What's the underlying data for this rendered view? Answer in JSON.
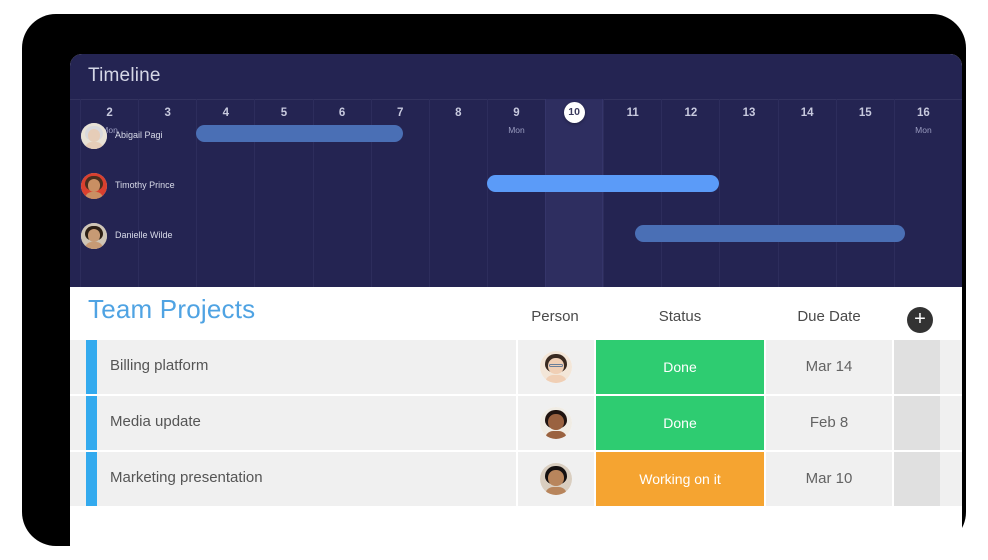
{
  "timeline": {
    "title": "Timeline",
    "days": [
      {
        "num": "2",
        "dow": "Mon",
        "today": false
      },
      {
        "num": "3",
        "dow": "",
        "today": false
      },
      {
        "num": "4",
        "dow": "",
        "today": false
      },
      {
        "num": "5",
        "dow": "",
        "today": false
      },
      {
        "num": "6",
        "dow": "",
        "today": false
      },
      {
        "num": "7",
        "dow": "",
        "today": false
      },
      {
        "num": "8",
        "dow": "",
        "today": false
      },
      {
        "num": "9",
        "dow": "Mon",
        "today": false
      },
      {
        "num": "10",
        "dow": "",
        "today": true
      },
      {
        "num": "11",
        "dow": "",
        "today": false
      },
      {
        "num": "12",
        "dow": "",
        "today": false
      },
      {
        "num": "13",
        "dow": "",
        "today": false
      },
      {
        "num": "14",
        "dow": "",
        "today": false
      },
      {
        "num": "15",
        "dow": "",
        "today": false
      },
      {
        "num": "16",
        "dow": "Mon",
        "today": false
      }
    ],
    "rows": [
      {
        "person": "Abigail  Pagi",
        "bar": {
          "start_day": 4.0,
          "end_day": 7.55,
          "color": "#4a6fb5"
        },
        "avatar": {
          "skin": "#e6cdb8",
          "hair": "#d8d8dc",
          "shirt": "#e8e2d6"
        }
      },
      {
        "person": "Timothy Prince",
        "bar": {
          "start_day": 9.0,
          "end_day": 13.0,
          "color": "#5b9bf8"
        },
        "avatar": {
          "skin": "#c98f63",
          "hair": "#4a2f1e",
          "shirt": "#d9402f"
        }
      },
      {
        "person": "Danielle Wilde",
        "bar": {
          "start_day": 11.55,
          "end_day": 16.2,
          "color": "#4a6fb5"
        },
        "avatar": {
          "skin": "#c79a74",
          "hair": "#2d2015",
          "shirt": "#cfc5b6"
        }
      }
    ]
  },
  "projects": {
    "title": "Team Projects",
    "add_label": "+",
    "columns": {
      "person": "Person",
      "status": "Status",
      "due_date": "Due Date"
    },
    "accent_color": "#33aaee",
    "status_colors": {
      "done": "#2ecc71",
      "working": "#f5a431"
    },
    "rows": [
      {
        "name": "Billing platform",
        "status": "Done",
        "status_color": "#2ecc71",
        "due_date": "Mar 14",
        "avatar": {
          "skin": "#f0cfb5",
          "hair": "#3a2a20",
          "shirt": "#f3e6d8",
          "glasses": true
        }
      },
      {
        "name": "Media update",
        "status": "Done",
        "status_color": "#2ecc71",
        "due_date": "Feb 8",
        "avatar": {
          "skin": "#9a6240",
          "hair": "#201410",
          "shirt": "#f0ece4",
          "glasses": false
        }
      },
      {
        "name": "Marketing presentation",
        "status": "Working on it",
        "status_color": "#f5a431",
        "due_date": "Mar 10",
        "avatar": {
          "skin": "#b8855c",
          "hair": "#141010",
          "shirt": "#d9cec0",
          "glasses": false
        }
      }
    ]
  }
}
